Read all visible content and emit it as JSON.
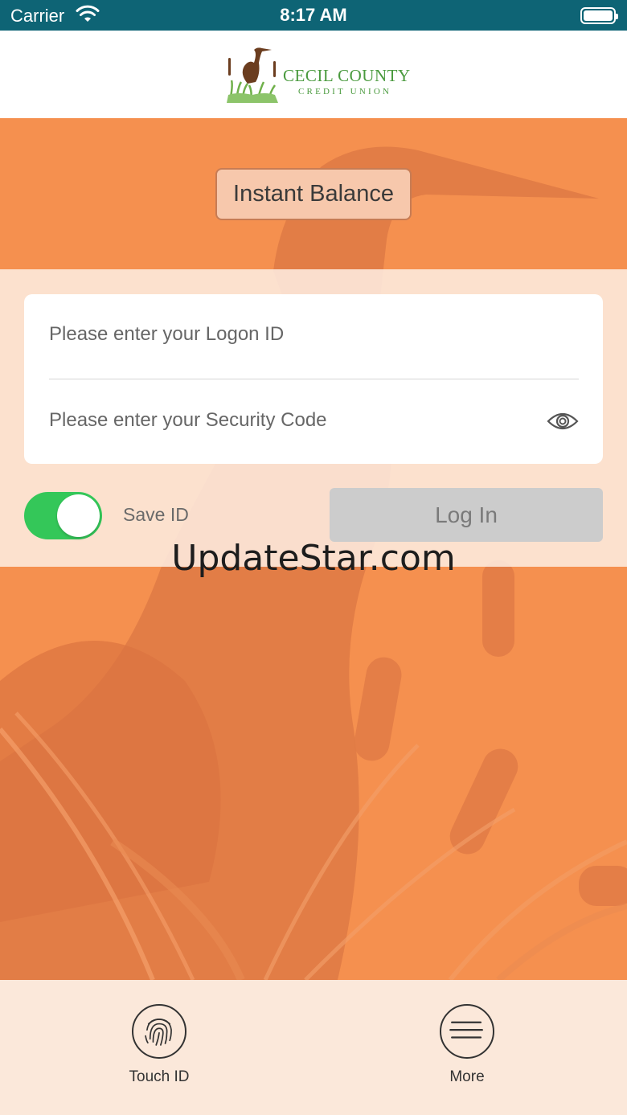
{
  "status_bar": {
    "carrier": "Carrier",
    "time": "8:17 AM",
    "battery_level": 1.0
  },
  "header": {
    "logo_line1": "CECIL COUNTY",
    "logo_line2": "CREDIT UNION",
    "brand_color": "#4a9a3e"
  },
  "instant_balance": {
    "label": "Instant Balance"
  },
  "login_form": {
    "logon_placeholder": "Please enter your Logon ID",
    "security_placeholder": "Please enter your Security Code",
    "logon_value": "",
    "security_value": "",
    "show_password_icon": "eye-icon"
  },
  "save_id": {
    "label": "Save ID",
    "enabled": true,
    "toggle_color": "#34c759"
  },
  "login_button": {
    "label": "Log In"
  },
  "watermark": "UpdateStar.com",
  "bottom_nav": {
    "items": [
      {
        "label": "Touch ID",
        "icon": "fingerprint-icon"
      },
      {
        "label": "More",
        "icon": "hamburger-menu-icon"
      }
    ]
  },
  "colors": {
    "status_bar": "#0e6475",
    "background_orange": "#f5904f",
    "accent_toggle": "#34c759"
  }
}
